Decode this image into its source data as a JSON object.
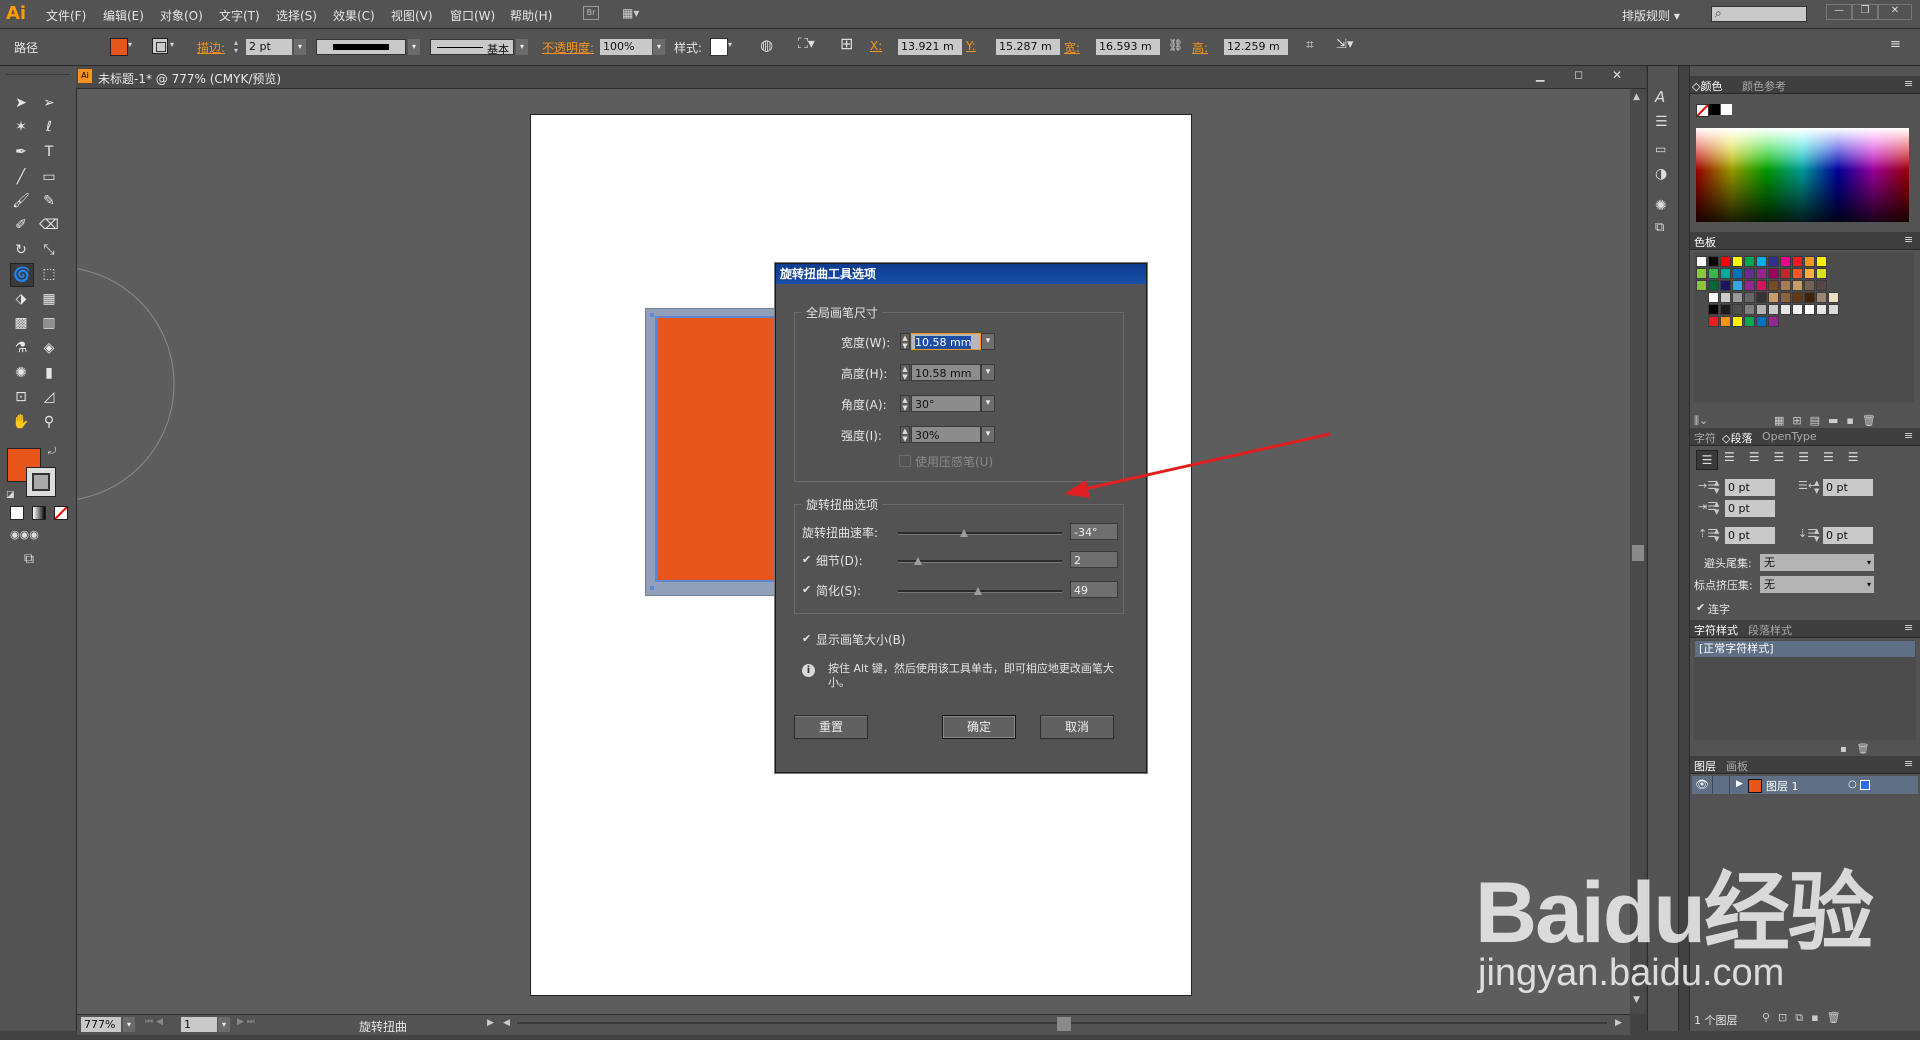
{
  "app": {
    "logo": "Ai",
    "workspace": "排版规则",
    "search_placeholder": ""
  },
  "menu": [
    "文件(F)",
    "编辑(E)",
    "对象(O)",
    "文字(T)",
    "选择(S)",
    "效果(C)",
    "视图(V)",
    "窗口(W)",
    "帮助(H)"
  ],
  "control": {
    "selection_label": "路径",
    "stroke_label": "描边:",
    "stroke_value": "2 pt",
    "brush_label": "基本",
    "opacity_label": "不透明度:",
    "opacity_value": "100%",
    "style_label": "样式:",
    "x_label": "X:",
    "x_value": "13.921 m",
    "y_label": "Y:",
    "y_value": "15.287 m",
    "w_label": "宽:",
    "w_value": "16.593 m",
    "h_label": "高:",
    "h_value": "12.259 m"
  },
  "doc_tab": {
    "title": "未标题-1* @ 777% (CMYK/预览)"
  },
  "dialog": {
    "title": "旋转扭曲工具选项",
    "group1_title": "全局画笔尺寸",
    "width_label": "宽度(W):",
    "width_value": "10.58 mm",
    "height_label": "高度(H):",
    "height_value": "10.58 mm",
    "angle_label": "角度(A):",
    "angle_value": "30°",
    "intensity_label": "强度(I):",
    "intensity_value": "30%",
    "pressure_label": "使用压感笔(U)",
    "group2_title": "旋转扭曲选项",
    "rate_label": "旋转扭曲速率:",
    "rate_value": "-34°",
    "detail_label": "细节(D):",
    "detail_value": "2",
    "simplify_label": "简化(S):",
    "simplify_value": "49",
    "show_size_label": "显示画笔大小(B)",
    "info_text": "按住 Alt 键，然后使用该工具单击，即可相应地更改画笔大小。",
    "reset_label": "重置",
    "ok_label": "确定",
    "cancel_label": "取消",
    "rate_slider_fraction": 0.4,
    "detail_slider_fraction": 0.12,
    "simplify_slider_fraction": 0.49
  },
  "panels": {
    "color_tab": "颜色",
    "color_ref_tab": "颜色参考",
    "swatches_tab": "色板",
    "char_tab": "字符",
    "para_tab": "段落",
    "opentype_tab": "OpenType",
    "para_left_indent": "0 pt",
    "para_right_indent": "0 pt",
    "para_first_indent": "0 pt",
    "para_space_before": "0 pt",
    "para_space_after": "0 pt",
    "kinsoku_label": "避头尾集:",
    "kinsoku_value": "无",
    "mojikumi_label": "标点挤压集:",
    "mojikumi_value": "无",
    "hyphen_label": "连字",
    "char_style_tab": "字符样式",
    "para_style_tab": "段落样式",
    "char_style_item": "[正常字符样式]",
    "layers_tab": "图层",
    "artboards_tab": "画板",
    "layer_name": "图层 1",
    "layer_count": "1 个图层"
  },
  "status": {
    "zoom": "777%",
    "artboard": "1",
    "tool_name": "旋转扭曲"
  },
  "watermark": {
    "brand": "Baidu经验",
    "url": "jingyan.baidu.com"
  },
  "colors": {
    "fill": "#e8561b",
    "accent": "#f7941d"
  }
}
